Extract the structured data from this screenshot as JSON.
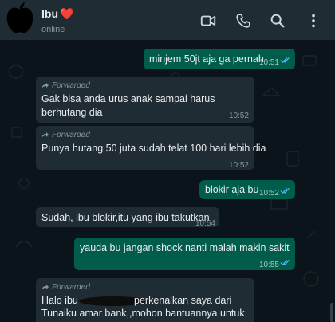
{
  "header": {
    "contact_name": "Ibu",
    "heart": "❤️",
    "status": "online",
    "icons": [
      "video-call-icon",
      "voice-call-icon",
      "search-icon",
      "more-options-icon"
    ]
  },
  "colors": {
    "header_bg": "#1f2c33",
    "chat_bg": "#0b141a",
    "outgoing_bubble": "#005c4b",
    "incoming_bubble": "#202c33",
    "read_ticks": "#53bdeb"
  },
  "messages": [
    {
      "direction": "out",
      "forwarded": false,
      "text": "minjem 50jt aja ga pernah",
      "time": "10:51",
      "status": "read"
    },
    {
      "direction": "in",
      "forwarded": true,
      "forwarded_label": "Forwarded",
      "text": "Gak bisa anda urus anak sampai harus berhutang dia",
      "time": "10:52"
    },
    {
      "direction": "in",
      "forwarded": true,
      "forwarded_label": "Forwarded",
      "text": "Punya hutang 50 juta sudah telat 100 hari lebih dia",
      "time": "10:52"
    },
    {
      "direction": "out",
      "forwarded": false,
      "text": "blokir aja bu",
      "time": "10:52",
      "status": "read"
    },
    {
      "direction": "in",
      "forwarded": false,
      "text": "Sudah, ibu blokir,itu yang ibu takutkan",
      "time": "10:54"
    },
    {
      "direction": "out",
      "forwarded": false,
      "text": "yauda bu jangan shock nanti malah makin sakit",
      "time": "10:55",
      "status": "read"
    },
    {
      "direction": "in",
      "forwarded": true,
      "forwarded_label": "Forwarded",
      "text_line1_a": "Halo ibu",
      "text_line1_b": "perkenalkan saya dari",
      "text_line2": "Tunaiku amar bank,,mohon bantuannya untuk"
    }
  ]
}
